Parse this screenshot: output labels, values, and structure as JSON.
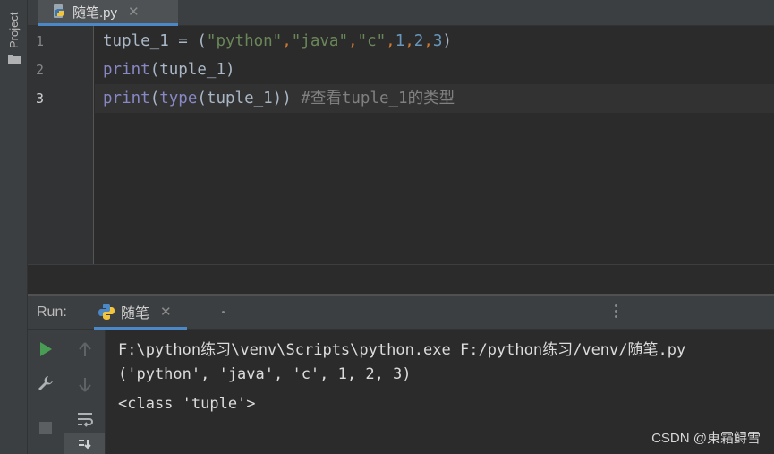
{
  "project_strip": {
    "label": "Project"
  },
  "editor_tab": {
    "title": "随笔.py",
    "close": "✕"
  },
  "gutter": {
    "line_numbers": [
      "1",
      "2",
      "3"
    ]
  },
  "code": {
    "line1": {
      "var": "tuple_1",
      "assign": " = (",
      "s1": "\"python\"",
      "c1": ",",
      "s2": "\"java\"",
      "c2": ",",
      "s3": "\"c\"",
      "c3": ",",
      "n1": "1",
      "c4": ",",
      "n2": "2",
      "c5": ",",
      "n3": "3",
      "close": ")"
    },
    "line2": {
      "fn": "print",
      "args": "(tuple_1)"
    },
    "line3": {
      "fn": "print",
      "open": "(",
      "fn2": "type",
      "args": "(tuple_1))",
      "comment": " #查看tuple_1的类型"
    }
  },
  "run_panel": {
    "label": "Run:",
    "tab_title": "随笔",
    "tab_close": "✕"
  },
  "console": {
    "lines": [
      "F:\\python练习\\venv\\Scripts\\python.exe F:/python练习/venv/随笔.py",
      "('python', 'java', 'c', 1, 2, 3)",
      "<class 'tuple'>"
    ]
  },
  "watermark": "CSDN @東霜鲟雪",
  "colors": {
    "background": "#2b2b2b",
    "string": "#6a8759",
    "number": "#6897bb",
    "builtin": "#8888c6",
    "comment": "#808080",
    "accent": "#4a88c7"
  },
  "icons": [
    "python-file-icon",
    "folder-icon",
    "run-icon",
    "wrench-icon",
    "stop-icon",
    "arrow-up-icon",
    "arrow-down-icon",
    "soft-wrap-icon",
    "scroll-to-end-icon",
    "python-icon"
  ]
}
